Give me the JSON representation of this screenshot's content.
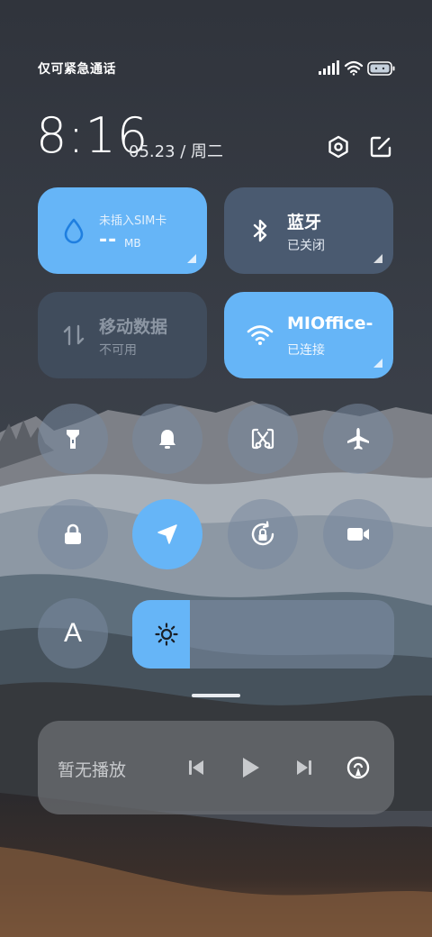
{
  "status_bar": {
    "carrier_text": "仅可紧急通话",
    "icons": [
      "signal-icon",
      "wifi-icon",
      "battery-icon"
    ]
  },
  "header": {
    "time": "8:16",
    "date": "05.23 / 周二",
    "buttons": [
      "settings-icon",
      "edit-icon"
    ]
  },
  "tiles": {
    "data_usage": {
      "title": "--",
      "unit": "MB",
      "subtitle": "未插入SIM卡",
      "icon": "water-drop-icon",
      "active": true
    },
    "bluetooth": {
      "title": "蓝牙",
      "subtitle": "已关闭",
      "icon": "bluetooth-icon",
      "active": false
    },
    "mobile_data": {
      "title": "移动数据",
      "subtitle": "不可用",
      "icon": "data-arrows-icon",
      "active": false
    },
    "wifi": {
      "title": "MIOffice-",
      "subtitle": "已连接",
      "icon": "wifi-icon",
      "active": true
    }
  },
  "toggles": [
    {
      "name": "flashlight",
      "icon": "flashlight-icon",
      "active": false
    },
    {
      "name": "sound",
      "icon": "bell-icon",
      "active": false
    },
    {
      "name": "screenshot",
      "icon": "screenshot-icon",
      "active": false
    },
    {
      "name": "airplane-mode",
      "icon": "airplane-icon",
      "active": false
    },
    {
      "name": "lock-screen",
      "icon": "lock-icon",
      "active": false
    },
    {
      "name": "location",
      "icon": "location-arrow-icon",
      "active": true
    },
    {
      "name": "rotation-lock",
      "icon": "rotation-lock-icon",
      "active": false
    },
    {
      "name": "screen-record",
      "icon": "video-camera-icon",
      "active": false
    },
    {
      "name": "font-size",
      "icon": "letter-a-icon",
      "label": "A",
      "active": false
    }
  ],
  "brightness": {
    "level": 0.22,
    "icon": "sun-icon"
  },
  "media": {
    "label": "暂无播放",
    "controls": [
      "previous-icon",
      "play-icon",
      "next-icon",
      "cast-icon"
    ]
  },
  "colors": {
    "accent": "#66b5f7",
    "tile_off": "#4a5a70",
    "tile_disabled": "#404c5c",
    "background_top": "#2f333b"
  }
}
